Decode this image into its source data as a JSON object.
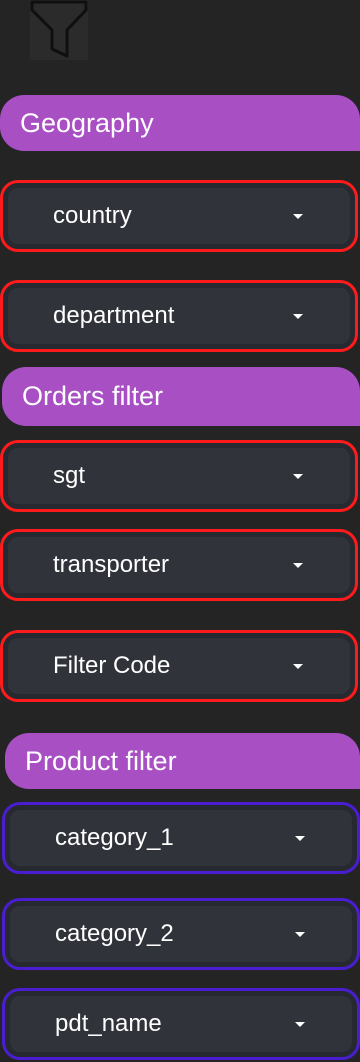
{
  "toolbar": {
    "filter_icon": "filter-funnel-icon"
  },
  "sections": [
    {
      "title": "Geography",
      "color": "#a84fc4",
      "filters": [
        {
          "label": "country",
          "border_color": "#ff1b1b"
        },
        {
          "label": "department",
          "border_color": "#ff1b1b"
        }
      ]
    },
    {
      "title": "Orders filter",
      "color": "#a84fc4",
      "filters": [
        {
          "label": "sgt",
          "border_color": "#ff1b1b"
        },
        {
          "label": "transporter",
          "border_color": "#ff1b1b"
        },
        {
          "label": "Filter Code",
          "border_color": "#ff1b1b"
        }
      ]
    },
    {
      "title": "Product filter",
      "color": "#a84fc4",
      "filters": [
        {
          "label": "category_1",
          "border_color": "#4a1ed0"
        },
        {
          "label": "category_2",
          "border_color": "#4a1ed0"
        },
        {
          "label": "pdt_name",
          "border_color": "#4a1ed0"
        }
      ]
    }
  ],
  "icons": {
    "dropdown_caret": "caret-down-icon"
  }
}
